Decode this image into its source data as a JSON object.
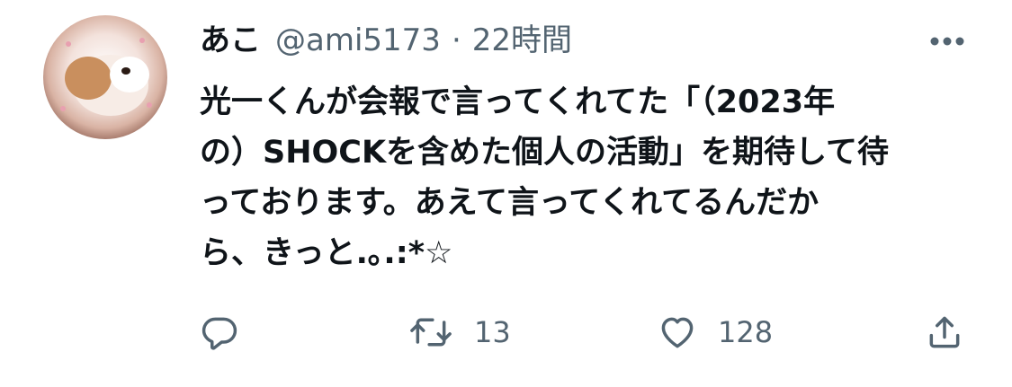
{
  "author": {
    "display_name": "あこ",
    "handle": "@ami5173",
    "separator": "·",
    "time": "22時間"
  },
  "tweet": {
    "lines": [
      "光一くんが会報で言ってくれてた「（2023年",
      "の）SHOCKを含めた個人の活動」を期待して待",
      "っております。あえて言ってくれてるんだか",
      "ら、きっと.｡.:*☆"
    ]
  },
  "actions": {
    "reply": {
      "icon": "reply-icon",
      "count": ""
    },
    "retweet": {
      "icon": "retweet-icon",
      "count": "13"
    },
    "like": {
      "icon": "heart-icon",
      "count": "128"
    },
    "share": {
      "icon": "share-icon",
      "count": ""
    }
  },
  "colors": {
    "text": "#0f1419",
    "secondary": "#536471",
    "background": "#ffffff"
  }
}
